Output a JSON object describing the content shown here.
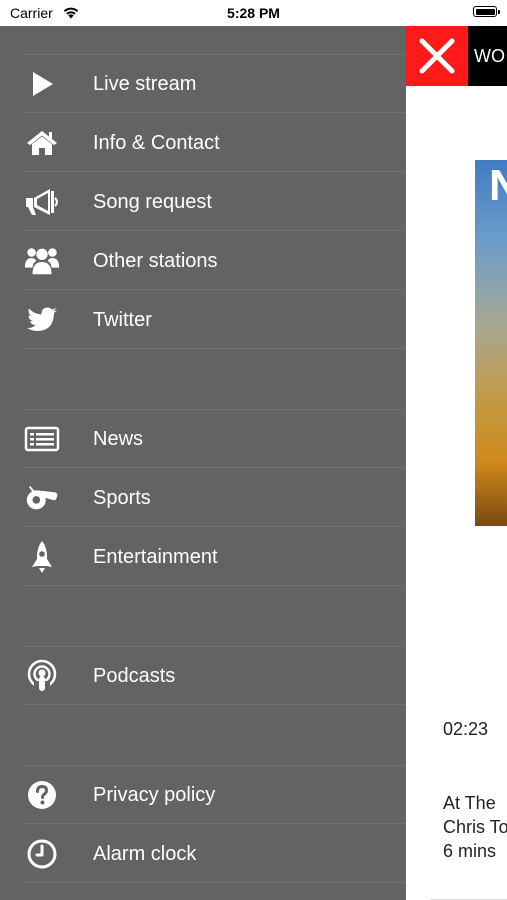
{
  "status_bar": {
    "carrier": "Carrier",
    "time": "5:28 PM"
  },
  "drawer": {
    "groups": [
      [
        {
          "label": "Live stream",
          "icon": "play-icon"
        },
        {
          "label": "Info & Contact",
          "icon": "home-icon"
        },
        {
          "label": "Song request",
          "icon": "megaphone-icon"
        },
        {
          "label": "Other stations",
          "icon": "group-icon"
        },
        {
          "label": "Twitter",
          "icon": "twitter-icon"
        }
      ],
      [
        {
          "label": "News",
          "icon": "newspaper-icon"
        },
        {
          "label": "Sports",
          "icon": "whistle-icon"
        },
        {
          "label": "Entertainment",
          "icon": "rocket-icon"
        }
      ],
      [
        {
          "label": "Podcasts",
          "icon": "podcast-icon"
        }
      ],
      [
        {
          "label": "Privacy policy",
          "icon": "question-icon"
        },
        {
          "label": "Alarm clock",
          "icon": "clock-icon"
        }
      ]
    ]
  },
  "content": {
    "header_title": "WO",
    "image_text": "N",
    "time": "02:23",
    "excerpt_lines": [
      "At The",
      "Chris To",
      "6 mins"
    ]
  },
  "colors": {
    "drawer_bg": "#636363",
    "close_bg": "#ff1a1a",
    "header_bg": "#000000"
  }
}
